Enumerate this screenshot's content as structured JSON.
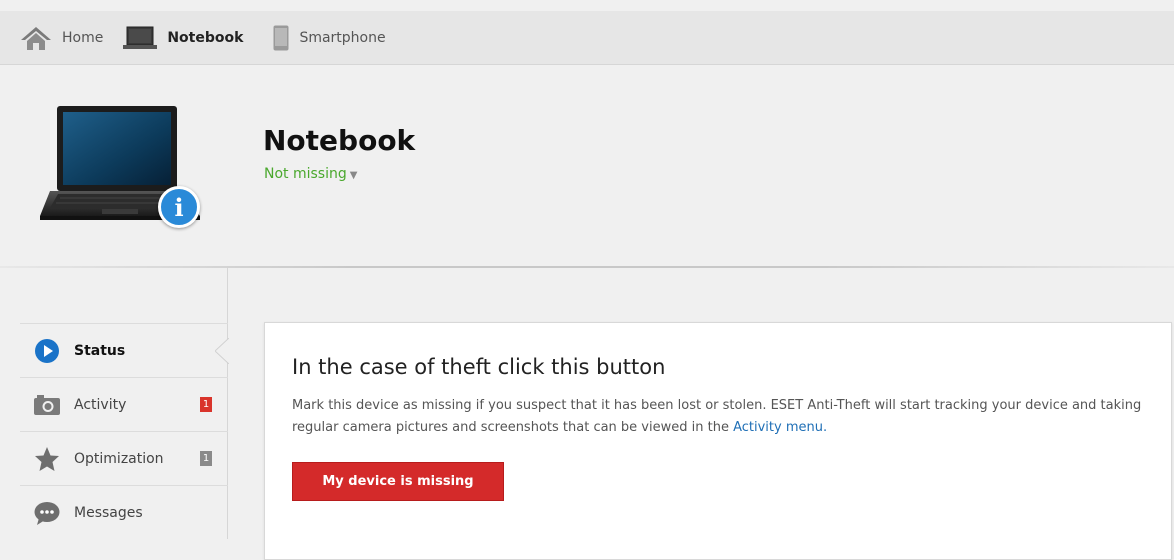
{
  "nav": {
    "home_label": "Home",
    "notebook_label": "Notebook",
    "smartphone_label": "Smartphone"
  },
  "device": {
    "title": "Notebook",
    "status": "Not missing",
    "status_caret": "▼",
    "info_icon": "i"
  },
  "sidebar": {
    "items": [
      {
        "label": "Status",
        "icon": "play-circle-icon",
        "active": true
      },
      {
        "label": "Activity",
        "icon": "camera-icon",
        "badge": "1",
        "badge_color": "#d9342b"
      },
      {
        "label": "Optimization",
        "icon": "star-icon",
        "badge": "1",
        "badge_color": "#8a8a8a"
      },
      {
        "label": "Messages",
        "icon": "chat-bubble-icon"
      }
    ]
  },
  "card": {
    "title": "In the case of theft click this button",
    "text_before_link": "Mark this device as missing if you suspect that it has been lost or stolen. ESET Anti-Theft will start tracking your device and taking regular camera pictures and screenshots that can be viewed in the ",
    "link_text": "Activity menu.",
    "button_label": "My device is missing"
  },
  "colors": {
    "accent_blue": "#1a73c8",
    "status_green": "#4aa82d",
    "button_red": "#d42a2a"
  }
}
